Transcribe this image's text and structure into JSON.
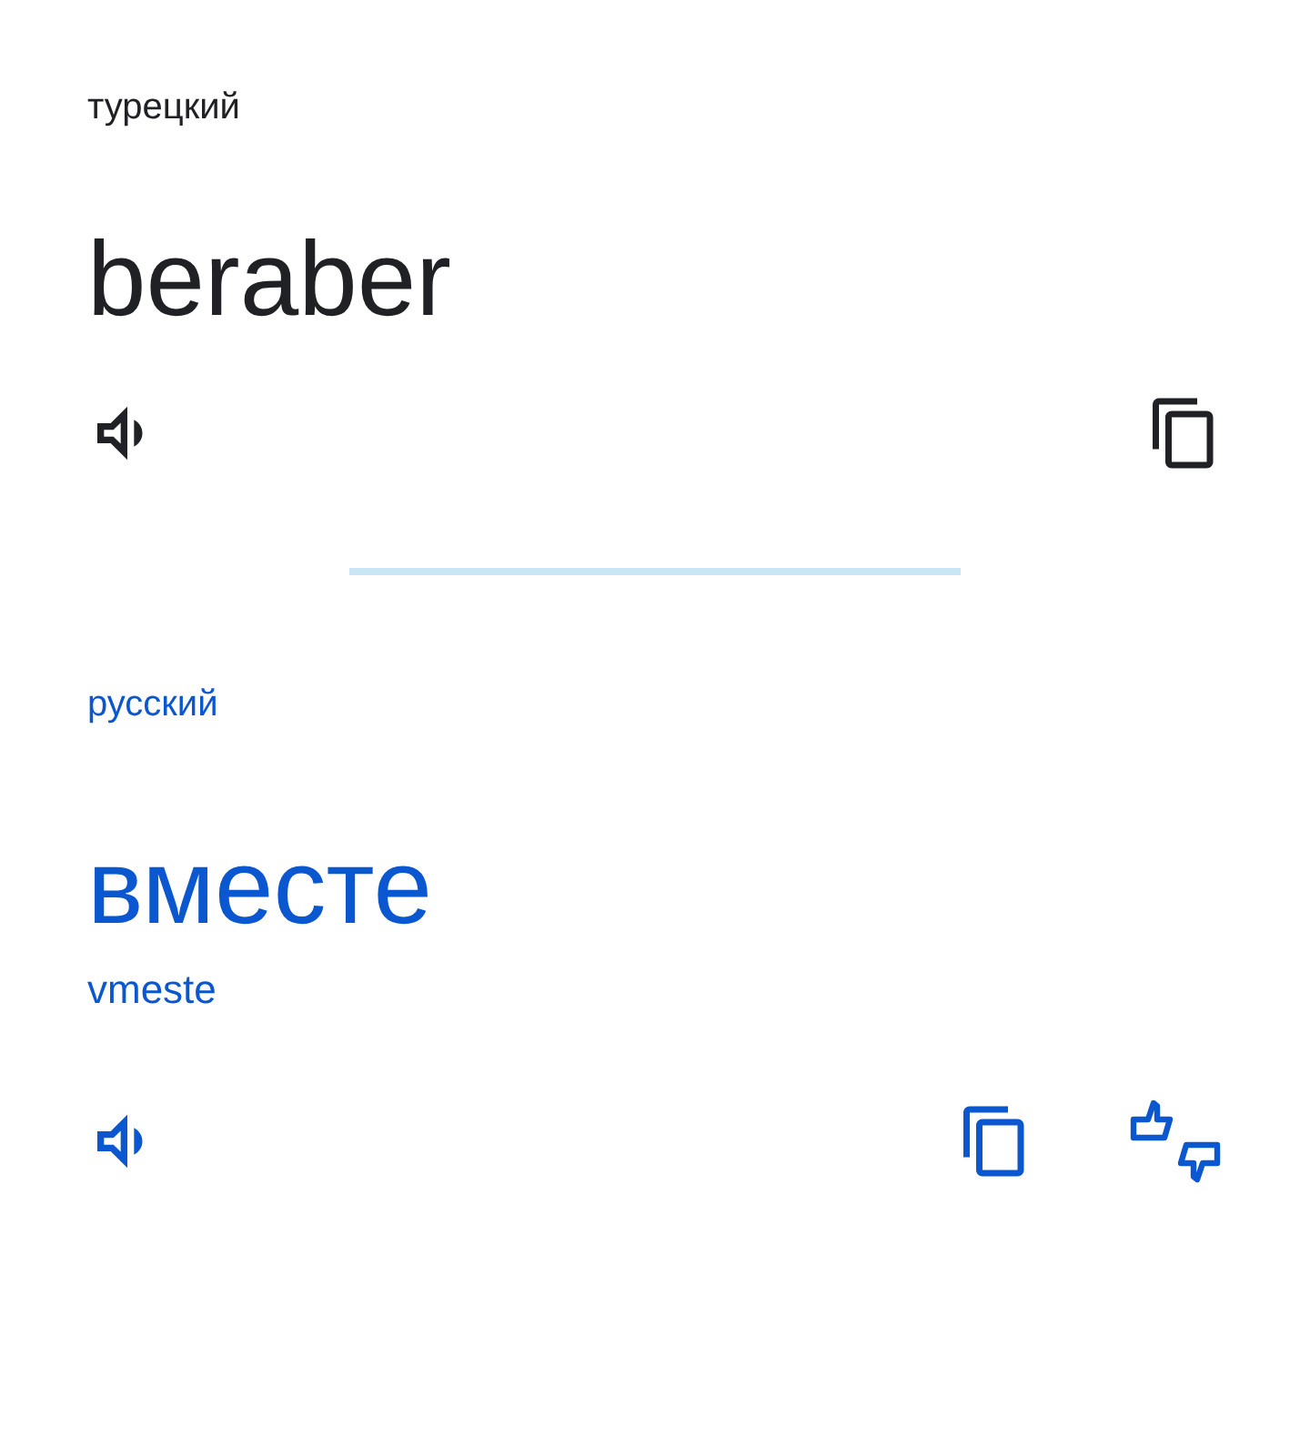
{
  "source": {
    "language": "турецкий",
    "text": "beraber"
  },
  "target": {
    "language": "русский",
    "text": "вместе",
    "transliteration": "vmeste"
  }
}
